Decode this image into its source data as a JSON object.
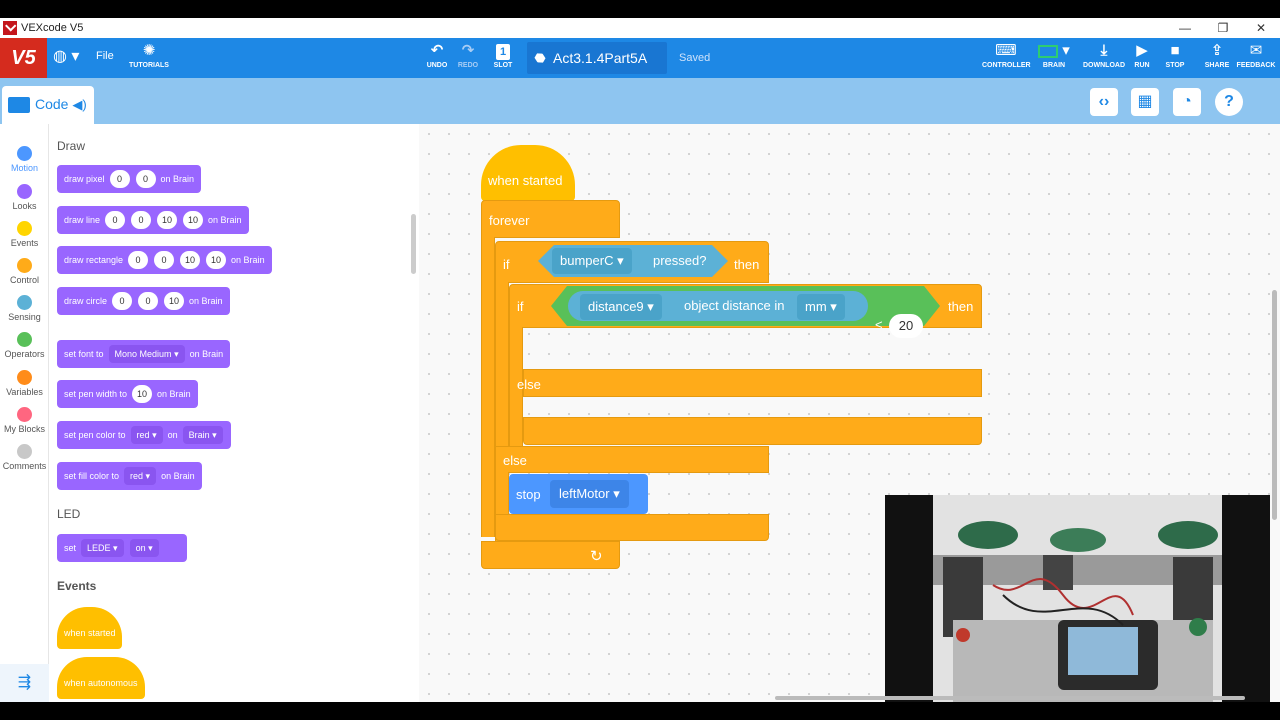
{
  "window": {
    "title": "VEXcode V5"
  },
  "toolbar": {
    "logo": "V5",
    "file": "File",
    "tutorials": "TUTORIALS",
    "undo": "UNDO",
    "redo": "REDO",
    "slot": "SLOT",
    "slot_number": "1",
    "project_name": "Act3.1.4Part5A",
    "saved": "Saved",
    "controller": "CONTROLLER",
    "brain": "BRAIN",
    "download": "DOWNLOAD",
    "run": "RUN",
    "stop": "STOP",
    "share": "SHARE",
    "feedback": "FEEDBACK"
  },
  "tab": {
    "code": "Code"
  },
  "categories": [
    {
      "label": "Motion",
      "color": "#4c97ff"
    },
    {
      "label": "Looks",
      "color": "#9966ff"
    },
    {
      "label": "Events",
      "color": "#ffd500"
    },
    {
      "label": "Control",
      "color": "#ffab19"
    },
    {
      "label": "Sensing",
      "color": "#5cb1d6"
    },
    {
      "label": "Operators",
      "color": "#59c059"
    },
    {
      "label": "Variables",
      "color": "#ff8c1a"
    },
    {
      "label": "My Blocks",
      "color": "#ff6680"
    },
    {
      "label": "Comments",
      "color": "#c8c8c8"
    }
  ],
  "palette": {
    "draw_header": "Draw",
    "led_header": "LED",
    "events_header": "Events",
    "draw_pixel": {
      "a": "draw pixel",
      "x": "0",
      "y": "0",
      "b": "on Brain"
    },
    "draw_line": {
      "a": "draw line",
      "x1": "0",
      "y1": "0",
      "x2": "10",
      "y2": "10",
      "b": "on Brain"
    },
    "draw_rect": {
      "a": "draw rectangle",
      "x": "0",
      "y": "0",
      "w": "10",
      "h": "10",
      "b": "on Brain"
    },
    "draw_circle": {
      "a": "draw circle",
      "x": "0",
      "y": "0",
      "r": "10",
      "b": "on Brain"
    },
    "set_font": {
      "a": "set font to",
      "font": "Mono Medium",
      "b": "on Brain"
    },
    "set_pen_width": {
      "a": "set pen width to",
      "w": "10",
      "b": "on Brain"
    },
    "set_pen_color": {
      "a": "set pen color to",
      "color": "red",
      "on": "on",
      "dev": "Brain"
    },
    "set_fill_color": {
      "a": "set fill color to",
      "color": "red",
      "b": "on Brain"
    },
    "set_led": {
      "a": "set",
      "led": "LEDE",
      "state": "on"
    },
    "when_started": "when started",
    "when_autonomous": "when autonomous"
  },
  "script": {
    "when_started": "when started",
    "forever": "forever",
    "if1": "if",
    "bumper": "bumperC",
    "pressed": "pressed?",
    "then1": "then",
    "if2": "if",
    "distance": "distance9",
    "object_distance_in": "object distance in",
    "unit": "mm",
    "lt": "<",
    "value": "20",
    "then2": "then",
    "else_inner": "else",
    "else_outer": "else",
    "stop": "stop",
    "motor": "leftMotor"
  }
}
